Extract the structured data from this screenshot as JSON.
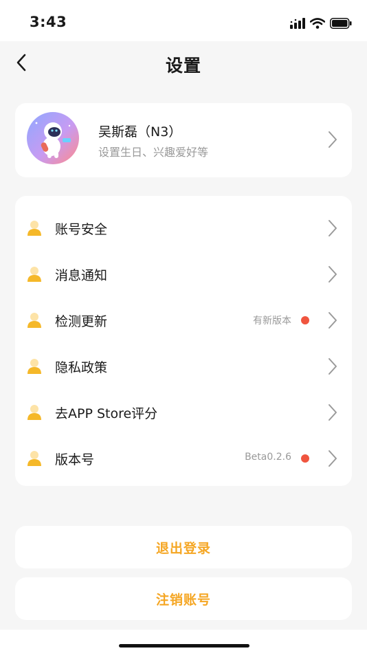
{
  "status_bar": {
    "time": "3:43",
    "icons": [
      "signal-icon",
      "wifi-icon",
      "battery-icon"
    ]
  },
  "nav": {
    "title": "设置",
    "back_icon": "chevron-left-icon"
  },
  "profile": {
    "name": "吴斯磊（N3）",
    "subtitle": "设置生日、兴趣爱好等",
    "avatar": "astronaut-avatar"
  },
  "menu": [
    {
      "label": "账号安全",
      "value": "",
      "dot": false,
      "icon": "user-icon"
    },
    {
      "label": "消息通知",
      "value": "",
      "dot": false,
      "icon": "user-icon"
    },
    {
      "label": "检测更新",
      "value": "有新版本",
      "dot": true,
      "icon": "user-icon"
    },
    {
      "label": "隐私政策",
      "value": "",
      "dot": false,
      "icon": "user-icon"
    },
    {
      "label": "去APP Store评分",
      "value": "",
      "dot": false,
      "icon": "user-icon"
    },
    {
      "label": "版本号",
      "value": "Beta0.2.6",
      "dot": true,
      "icon": "user-icon"
    }
  ],
  "buttons": {
    "logout": "退出登录",
    "deactivate": "注销账号"
  },
  "colors": {
    "accent": "#f5a623",
    "dot": "#f0553f",
    "background": "#f6f6f6",
    "card": "#ffffff"
  }
}
